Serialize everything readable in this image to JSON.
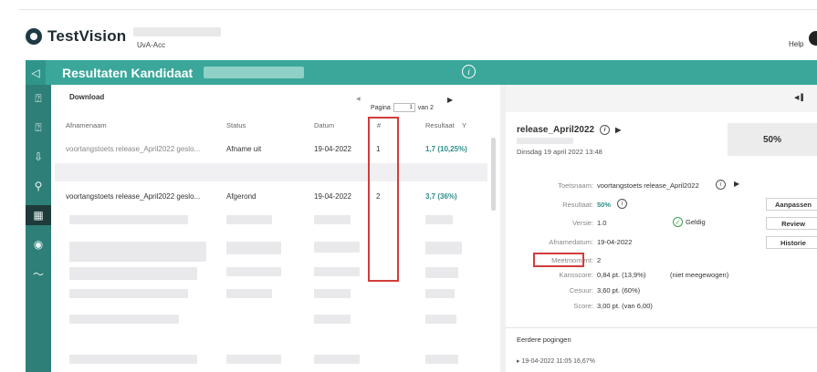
{
  "header": {
    "app_name": "TestVision",
    "environment": "UvA-Acc",
    "help_label": "Help"
  },
  "titlebar": {
    "title": "Resultaten Kandidaat",
    "back_icon": "chevron-left-icon",
    "info_icon": "info-icon"
  },
  "sidebar": {
    "items": [
      {
        "icon": "question-icon",
        "glyph": "?"
      },
      {
        "icon": "question-box-icon",
        "glyph": "?"
      },
      {
        "icon": "download-box-icon",
        "glyph": "⇩"
      },
      {
        "icon": "user-search-icon",
        "glyph": "⚲"
      },
      {
        "icon": "calendar-icon",
        "glyph": "▦"
      },
      {
        "icon": "eye-icon",
        "glyph": "◉"
      },
      {
        "icon": "chart-icon",
        "glyph": "〜"
      }
    ]
  },
  "list": {
    "download_label": "Download",
    "pager": {
      "prefix": "Pagina",
      "current": "1",
      "suffix": "van 2"
    },
    "columns": [
      "Afnamenaam",
      "Status",
      "Datum",
      "#",
      "Resultaat"
    ],
    "rows": [
      {
        "name": "voortangstoets release_April2022 geslo...",
        "status": "Afname uit",
        "date": "19-04-2022",
        "number": "1",
        "result": "1,7 (10,25%)"
      },
      {
        "name": "voortangstoets release_April2022 geslo...",
        "status": "Afgerond",
        "date": "19-04-2022",
        "number": "2",
        "result": "3,7 (36%)"
      }
    ]
  },
  "detail": {
    "title": "release_April2022",
    "date": "Dinsdag 19 april 2022 13:48",
    "score_percent": "50%",
    "fields": {
      "toetsnaam_label": "Toetsnaam:",
      "toetsnaam_value": "voortangstoets release_April2022",
      "resultaat_label": "Resultaat:",
      "resultaat_value": "50%",
      "versie_label": "Versie:",
      "versie_value": "1.0",
      "geldig_label": "Geldig",
      "afnamedatum_label": "Afnamedatum:",
      "afnamedatum_value": "19-04-2022",
      "meetmoment_label": "Meetmoment:",
      "meetmoment_value": "2",
      "kansscore_label": "Kansscore:",
      "kansscore_value": "0,84 pt. (13,9%)",
      "kansscore_note": "(niet meegewogen)",
      "cesuur_label": "Cesuur:",
      "cesuur_value": "3,60 pt. (60%)",
      "score_label": "Score:",
      "score_value": "3,00 pt. (van 6,00)"
    },
    "buttons": {
      "aanpassen": "Aanpassen",
      "review": "Review",
      "historie": "Historie"
    },
    "previous_title": "Eerdere pogingen",
    "previous_item": "19-04-2022 11:05 16,67%"
  }
}
